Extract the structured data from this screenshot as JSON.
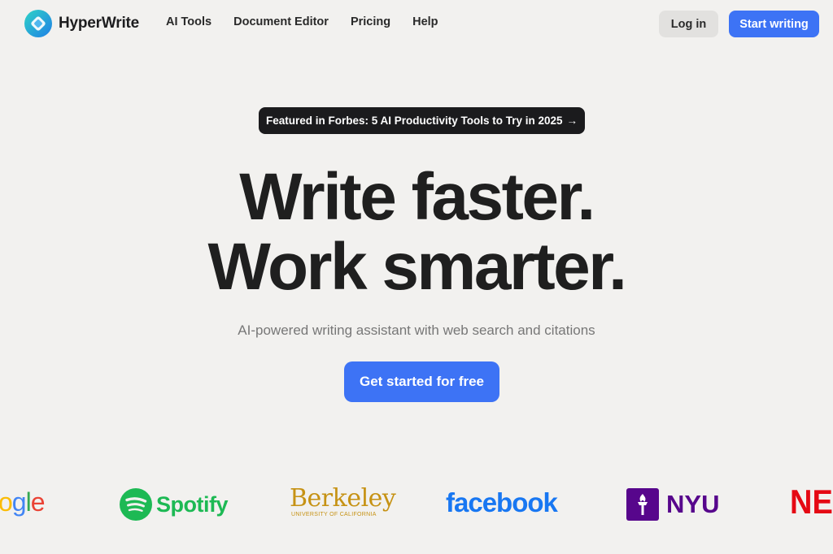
{
  "header": {
    "brand": "HyperWrite",
    "nav": [
      "AI Tools",
      "Document Editor",
      "Pricing",
      "Help"
    ],
    "login_label": "Log in",
    "start_label": "Start writing"
  },
  "hero": {
    "badge_text": "Featured in Forbes: 5 AI Productivity Tools to Try in 2025",
    "badge_arrow": "→",
    "headline_line1": "Write faster.",
    "headline_line2": "Work smarter.",
    "subtitle": "AI-powered writing assistant with web search and citations",
    "cta_label": "Get started for free"
  },
  "logos": {
    "google": "ogle",
    "spotify": "Spotify",
    "berkeley": "Berkeley",
    "berkeley_sub": "UNIVERSITY OF CALIFORNIA",
    "facebook": "facebook",
    "nyu": "NYU",
    "netflix": "NET"
  },
  "colors": {
    "background": "#f2f1ef",
    "accent": "#3d73f5",
    "badge_bg": "#1b1b1d"
  }
}
